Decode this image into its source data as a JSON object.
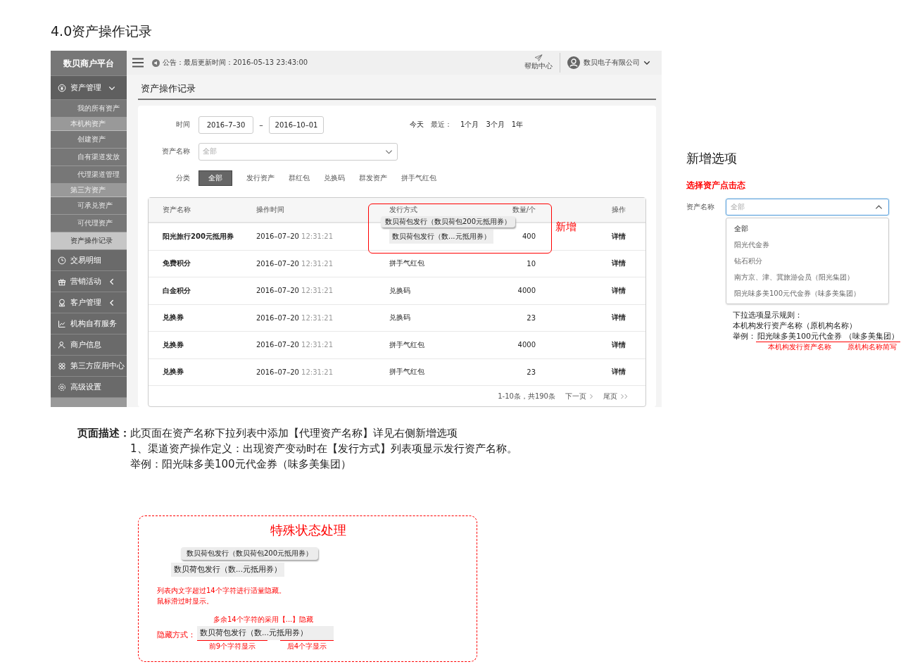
{
  "doc_title": "4.0资产操作记录",
  "app": {
    "brand": "数贝商户平台",
    "notice": "公告：最后更新时间：2016-05-13 23:43:00",
    "help": "帮助中心",
    "account": "数贝电子有限公司",
    "menu": [
      {
        "label": "资产管理",
        "expanded": true,
        "children": [
          {
            "kind": "link",
            "label": "我的所有资产",
            "selected": false
          },
          {
            "kind": "heading",
            "label": "本机构资产"
          },
          {
            "kind": "link",
            "label": "创建资产",
            "selected": false
          },
          {
            "kind": "link",
            "label": "自有渠道发放",
            "selected": false
          },
          {
            "kind": "link",
            "label": "代理渠道管理",
            "selected": false
          },
          {
            "kind": "heading",
            "label": "第三方资产"
          },
          {
            "kind": "link",
            "label": "可承兑资产",
            "selected": false
          },
          {
            "kind": "link",
            "label": "可代理资产",
            "selected": false
          },
          {
            "kind": "link",
            "label": "资产操作记录",
            "selected": true
          }
        ]
      },
      {
        "label": "交易明细"
      },
      {
        "label": "营销活动",
        "expanded": false
      },
      {
        "label": "客户管理",
        "expanded": false
      },
      {
        "label": "机构自有服务"
      },
      {
        "label": "商户信息"
      },
      {
        "label": "第三方应用中心"
      },
      {
        "label": "高级设置"
      }
    ],
    "page_title": "资产操作记录",
    "filters": {
      "time_label": "时间",
      "date_from": "2016–7–30",
      "date_sep": "–",
      "date_to": "2016–10–01",
      "today": "今天",
      "recent_label": "最近：",
      "ranges": [
        "1个月",
        "3个月",
        "1年"
      ],
      "asset_label": "资产名称",
      "asset_placeholder": "全部",
      "category_label": "分类",
      "categories": [
        {
          "label": "全部",
          "selected": true
        },
        {
          "label": "发行资产",
          "selected": false
        },
        {
          "label": "群红包",
          "selected": false
        },
        {
          "label": "兑换码",
          "selected": false
        },
        {
          "label": "群发资产",
          "selected": false
        },
        {
          "label": "拼手气红包",
          "selected": false
        }
      ]
    },
    "table": {
      "columns": [
        "资产名称",
        "操作时间",
        "发行方式",
        "数量/个",
        "操作"
      ],
      "rows": [
        {
          "name": "阳光旅行200元抵用券",
          "date": "2016–07–20",
          "time": "12:31:21",
          "method": "数贝荷包发行（数...元抵用券）",
          "tooltip": "数贝荷包发行（数贝荷包200元抵用券）",
          "quantity": "400",
          "action": "详情"
        },
        {
          "name": "免费积分",
          "date": "2016–07–20",
          "time": "12:31:21",
          "method": "拼手气红包",
          "quantity": "10",
          "action": "详情"
        },
        {
          "name": "白金积分",
          "date": "2016–07–20",
          "time": "12:31:21",
          "method": "兑换码",
          "quantity": "4000",
          "action": "详情"
        },
        {
          "name": "兑换券",
          "date": "2016–07–20",
          "time": "12:31:21",
          "method": "兑换码",
          "quantity": "23",
          "action": "详情"
        },
        {
          "name": "兑换券",
          "date": "2016–07–20",
          "time": "12:31:21",
          "method": "拼手气红包",
          "quantity": "4000",
          "action": "详情"
        },
        {
          "name": "兑换券",
          "date": "2016–07–20",
          "time": "12:31:21",
          "method": "拼手气红包",
          "quantity": "23",
          "action": "详情"
        }
      ],
      "pagination": {
        "summary": "1-10条，共190条",
        "next": "下一页",
        "last": "尾页"
      }
    },
    "annotation": "新增"
  },
  "new_option": {
    "title": "新增选项",
    "subtitle": "选择资产点击态",
    "field_label": "资产名称",
    "placeholder": "全部",
    "expanded": true,
    "options": [
      "全部",
      "阳光代金券",
      "钻石积分",
      "南方京、津、冀旅游会员（阳光集团）",
      "阳光味多美100元代金券（味多美集团）"
    ],
    "rule_title": "下拉选项显示规则：",
    "rule_format": "本机构发行资产名称（原机构名称）",
    "example_label": "举例：",
    "example_parts": [
      {
        "text": "阳光味多美100元代金券",
        "note": "本机构发行资产名称"
      },
      {
        "text": "（味多美集团）",
        "note": "原机构名称简写"
      }
    ]
  },
  "description": {
    "label": "页面描述：",
    "lines": [
      "此页面在资产名称下拉列表中添加【代理资产名称】详见右侧新增选项",
      "1、渠道资产操作定义：出现资产变动时在【发行方式】列表项显示发行资产名称。",
      "举例：阳光味多美100元代金券（味多美集团）"
    ]
  },
  "special": {
    "title": "特殊状态处理",
    "tooltip": "数贝荷包发行（数贝荷包200元抵用券）",
    "cell": "数贝荷包发行（数...元抵用券）",
    "notes": [
      "列表内文字超过14个字符进行适量隐藏。",
      "鼠标滑过时显示。"
    ],
    "hide_note": "多余14个字符的采用【...】隐藏",
    "hide_label": "隐藏方式：",
    "hide_cell": "数贝荷包发行（数...元抵用券）",
    "hide_parts": [
      "前9个字符显示",
      "后4个字显示"
    ]
  }
}
